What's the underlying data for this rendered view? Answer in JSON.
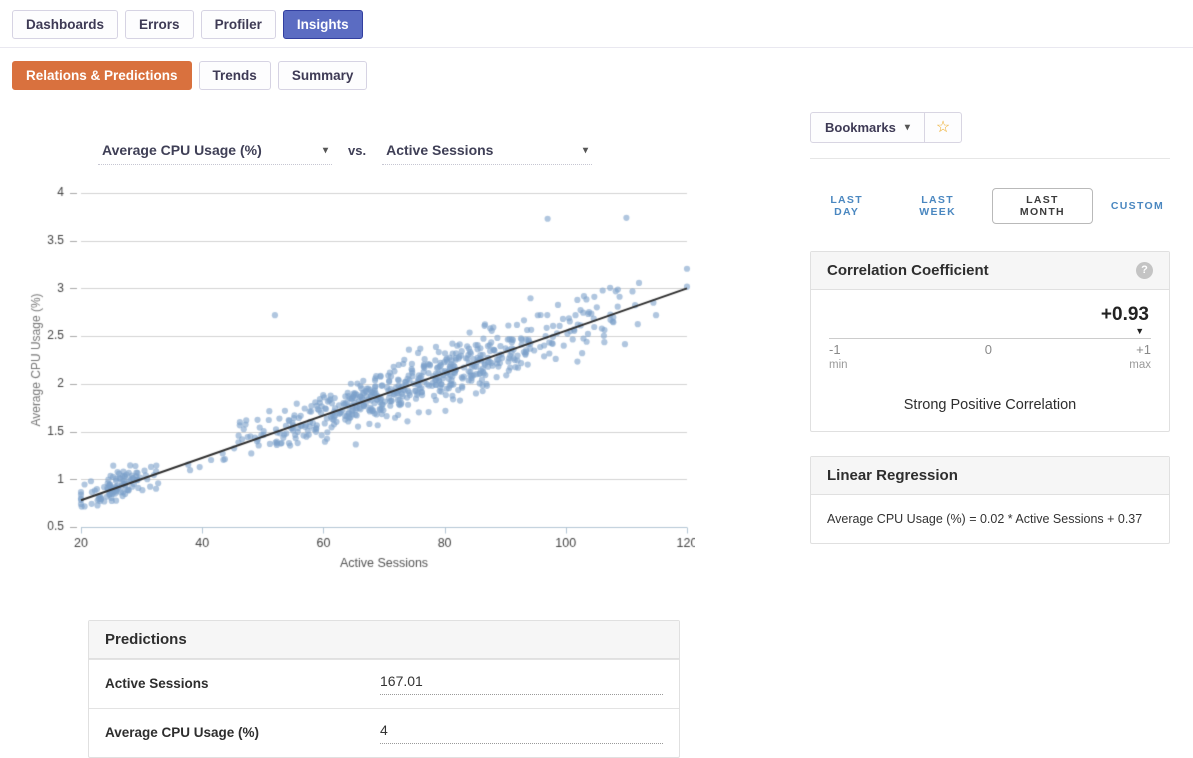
{
  "top_nav": {
    "tabs": [
      {
        "label": "Dashboards",
        "active": false
      },
      {
        "label": "Errors",
        "active": false
      },
      {
        "label": "Profiler",
        "active": false
      },
      {
        "label": "Insights",
        "active": true
      }
    ]
  },
  "sub_nav": {
    "tabs": [
      {
        "label": "Relations & Predictions",
        "active": true
      },
      {
        "label": "Trends",
        "active": false
      },
      {
        "label": "Summary",
        "active": false
      }
    ]
  },
  "selectors": {
    "y_metric": "Average CPU Usage (%)",
    "vs_label": "vs.",
    "x_metric": "Active Sessions"
  },
  "bookmarks": {
    "label": "Bookmarks"
  },
  "time_range": {
    "options": [
      {
        "label": "LAST DAY",
        "selected": false
      },
      {
        "label": "LAST WEEK",
        "selected": false
      },
      {
        "label": "LAST MONTH",
        "selected": true
      },
      {
        "label": "CUSTOM",
        "selected": false
      }
    ]
  },
  "correlation": {
    "title": "Correlation Coefficient",
    "value": "+0.93",
    "marker_pct": 96.5,
    "scale": {
      "min": "-1",
      "min_sub": "min",
      "mid": "0",
      "max": "+1",
      "max_sub": "max"
    },
    "description": "Strong Positive Correlation"
  },
  "regression_card": {
    "title": "Linear Regression",
    "equation": "Average CPU Usage (%) = 0.02 * Active Sessions + 0.37"
  },
  "predictions": {
    "title": "Predictions",
    "rows": [
      {
        "label": "Active Sessions",
        "value": "167.01"
      },
      {
        "label": "Average CPU Usage (%)",
        "value": "4"
      }
    ]
  },
  "icons": {
    "chevron_down": "▾",
    "star": "☆",
    "help": "?",
    "marker_down": "▼"
  },
  "colors": {
    "accent_blue": "#5b6cc2",
    "accent_orange": "#d9713e",
    "link_blue": "#4a87c0",
    "star_gold": "#eda921",
    "point_blue": "#7ba0ca",
    "trend_dark": "#2f2f2f",
    "grid_gray": "#d2d2d2",
    "axis_blue_gray": "#b3c6d4"
  },
  "chart_data": {
    "type": "scatter",
    "title": "",
    "xlabel": "Active Sessions",
    "ylabel": "Average CPU Usage (%)",
    "xlim": [
      20,
      120
    ],
    "ylim": [
      0.5,
      4
    ],
    "x_ticks": [
      20,
      40,
      60,
      80,
      100,
      120
    ],
    "y_ticks": [
      0.5,
      1,
      1.5,
      2,
      2.5,
      3,
      3.5,
      4
    ],
    "grid": "horizontal",
    "legend": "none",
    "point_color": "#7ba0ca",
    "point_opacity": 0.6,
    "point_radius": 3.1,
    "n_points": 720,
    "seed": 42,
    "x_clusters": [
      {
        "weight": 0.16,
        "mean": 26,
        "sd": 3.2
      },
      {
        "weight": 0.84,
        "mean": 76,
        "sd": 16
      }
    ],
    "regression": {
      "slope": 0.0222,
      "intercept": 0.336
    },
    "noise": {
      "base": 0.05,
      "per_x": 0.0012
    },
    "outliers": [
      [
        52,
        2.72
      ],
      [
        97,
        3.73
      ],
      [
        110,
        3.74
      ]
    ],
    "trend_line": {
      "x1": 20,
      "y1": 0.78,
      "x2": 120,
      "y2": 3.0,
      "color": "#2f2f2f",
      "width": 2
    }
  }
}
